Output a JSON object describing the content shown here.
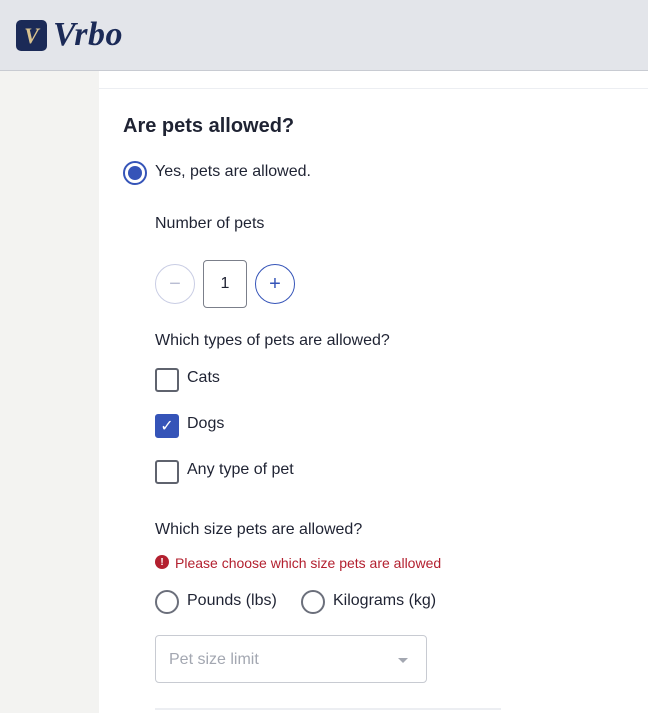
{
  "header": {
    "logo_mark": "V",
    "logo_text": "Vrbo"
  },
  "form": {
    "heading": "Are pets allowed?",
    "pets_allowed": {
      "option_label": "Yes, pets are allowed.",
      "selected": true
    },
    "number_of_pets": {
      "label": "Number of pets",
      "decrement_symbol": "−",
      "increment_symbol": "+",
      "value": "1"
    },
    "pet_types": {
      "question": "Which types of pets are allowed?",
      "options": [
        {
          "label": "Cats",
          "checked": false
        },
        {
          "label": "Dogs",
          "checked": true
        },
        {
          "label": "Any type of pet",
          "checked": false
        }
      ],
      "check_mark": "✓"
    },
    "pet_size": {
      "question": "Which size pets are allowed?",
      "error_icon": "!",
      "error_message": "Please choose which size pets are allowed",
      "units": [
        {
          "label": "Pounds (lbs)",
          "selected": false
        },
        {
          "label": "Kilograms (kg)",
          "selected": false
        }
      ],
      "size_limit_placeholder": "Pet size limit"
    }
  },
  "colors": {
    "accent": "#3554b8",
    "error": "#b3202f",
    "brand": "#1b2a57"
  }
}
